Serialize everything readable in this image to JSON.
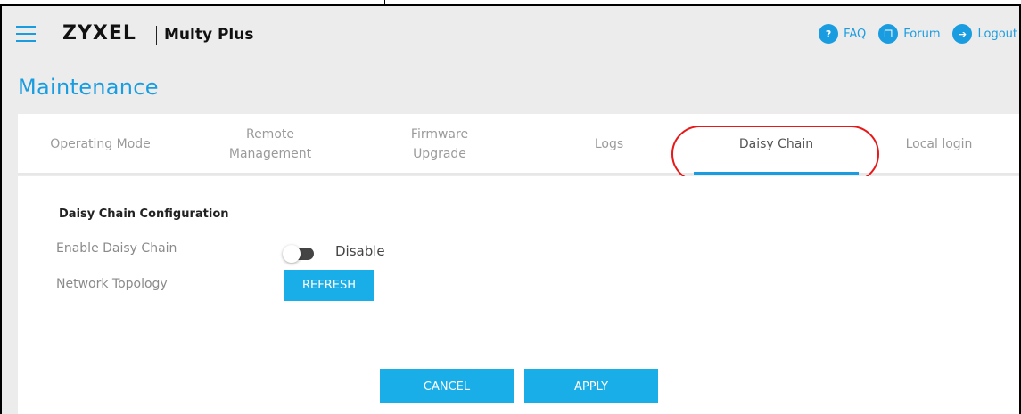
{
  "header": {
    "brand": "ZYXEL",
    "product": "Multy Plus",
    "links": [
      {
        "label": "FAQ",
        "icon": "faq-icon"
      },
      {
        "label": "Forum",
        "icon": "forum-icon"
      },
      {
        "label": "Logout",
        "icon": "logout-icon"
      }
    ]
  },
  "page_title": "Maintenance",
  "tabs": [
    {
      "label": "Operating Mode"
    },
    {
      "label": "Remote\nManagement"
    },
    {
      "label": "Firmware\nUpgrade"
    },
    {
      "label": "Logs"
    },
    {
      "label": "Daisy Chain",
      "active": true
    },
    {
      "label": "Local login"
    }
  ],
  "config": {
    "section_title": "Daisy Chain Configuration",
    "enable_label": "Enable Daisy Chain",
    "toggle_state": "Disable",
    "topology_label": "Network Topology",
    "refresh_label": "REFRESH"
  },
  "actions": {
    "cancel_label": "CANCEL",
    "apply_label": "APPLY"
  },
  "colors": {
    "accent": "#1a9de0",
    "button": "#1aaee8",
    "highlight": "#e81818"
  }
}
